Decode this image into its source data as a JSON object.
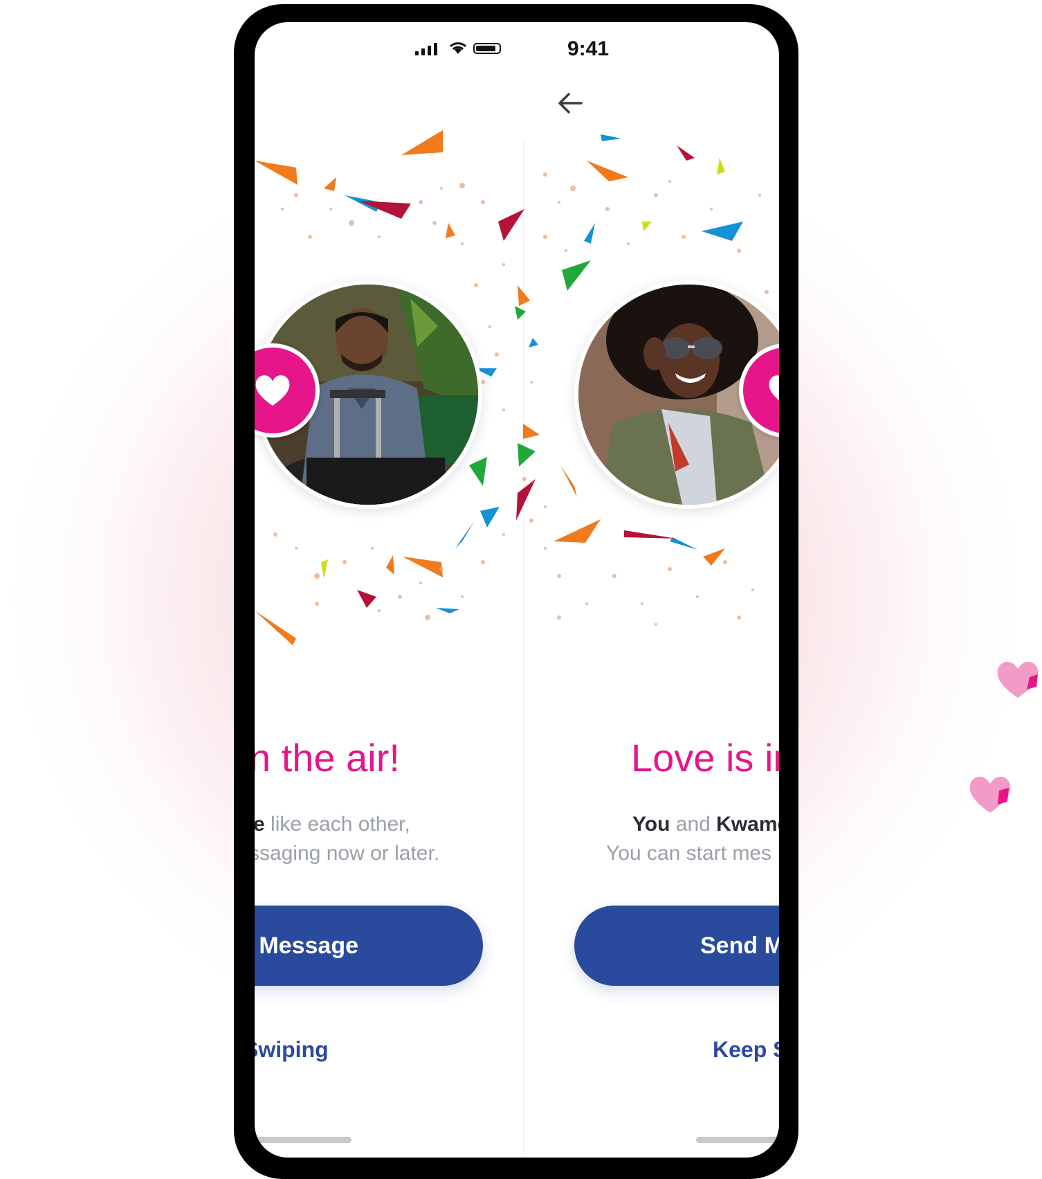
{
  "status_bar": {
    "time": "9:41"
  },
  "nav": {
    "back_icon": "arrow-left-icon"
  },
  "cards": [
    {
      "heading": "n the air!",
      "line1_bold": "e",
      "line1_rest": " like each other,",
      "line2": "ssaging now or later.",
      "primary_button": "Message",
      "secondary_link": "Swiping"
    },
    {
      "heading": "Love is in",
      "line1_you": "You",
      "line1_and": " and ",
      "line1_name": "Kwame",
      "line2": "You can start  mes",
      "primary_button": "Send M",
      "secondary_link": "Keep S"
    }
  ],
  "colors": {
    "accent_pink": "#e6168a",
    "primary_blue": "#2a4a9e",
    "subtext_gray": "#9aa0a8"
  }
}
